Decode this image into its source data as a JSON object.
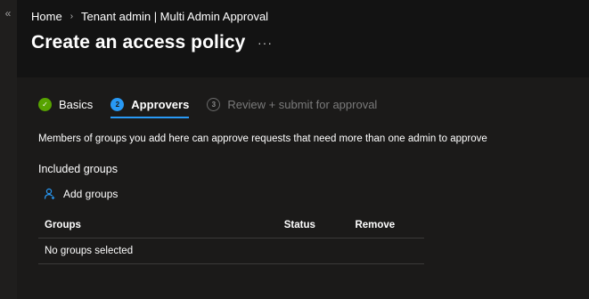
{
  "sidebar": {
    "collapse_glyph": "«"
  },
  "breadcrumb": {
    "items": [
      "Home",
      "Tenant admin | Multi Admin Approval"
    ],
    "separator": "›"
  },
  "page": {
    "title": "Create an access policy",
    "more_label": "···"
  },
  "wizard": {
    "steps": [
      {
        "number": "✓",
        "label": "Basics",
        "state": "done"
      },
      {
        "number": "2",
        "label": "Approvers",
        "state": "active"
      },
      {
        "number": "3",
        "label": "Review + submit for approval",
        "state": "pending"
      }
    ]
  },
  "approvers": {
    "description": "Members of groups you add here can approve requests that need more than one admin to approve",
    "section_title": "Included groups",
    "add_groups_label": "Add groups"
  },
  "table": {
    "columns": [
      "Groups",
      "Status",
      "Remove"
    ],
    "empty_message": "No groups selected"
  },
  "colors": {
    "accent": "#2899f5",
    "success": "#57a300",
    "background": "#1b1a19"
  }
}
